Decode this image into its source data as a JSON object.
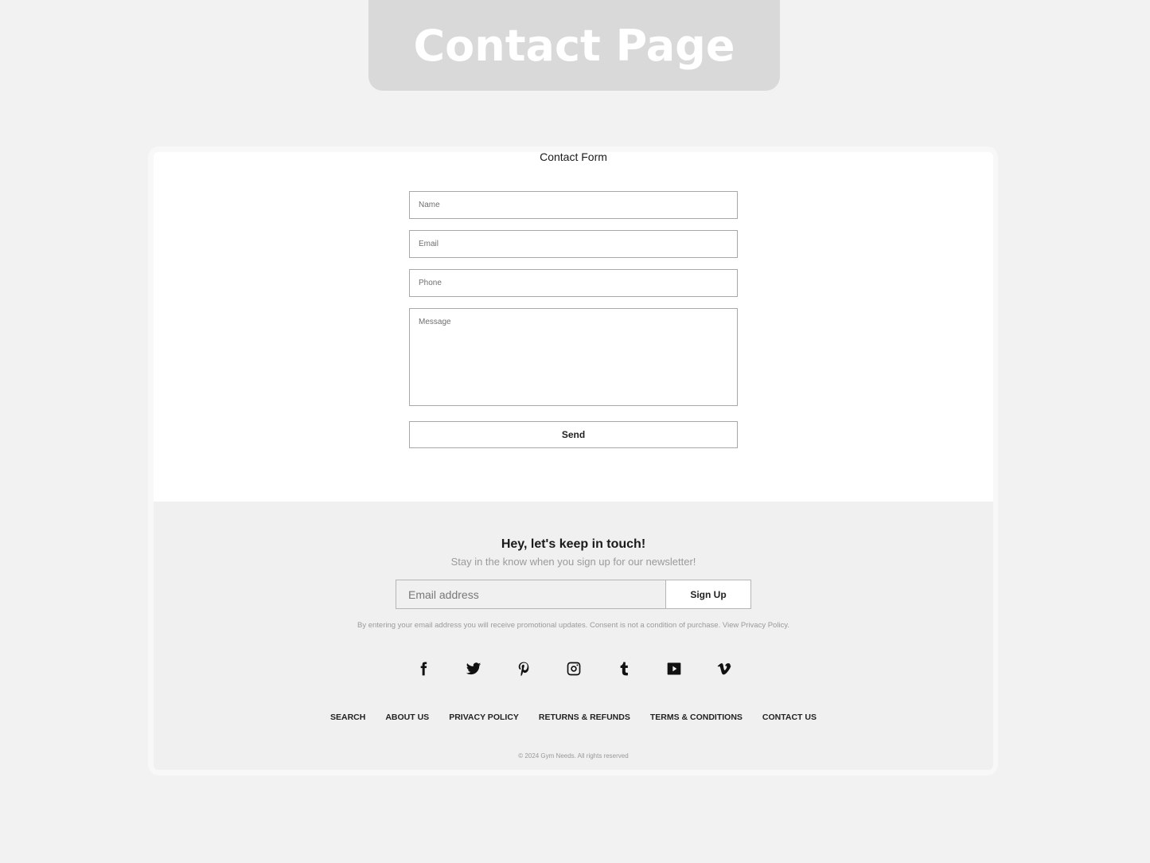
{
  "banner": {
    "title": "Contact Page"
  },
  "form": {
    "title": "Contact Form",
    "fields": [
      {
        "name": "name",
        "placeholder": "Name",
        "value": ""
      },
      {
        "name": "email",
        "placeholder": "Email",
        "value": ""
      },
      {
        "name": "phone",
        "placeholder": "Phone",
        "value": ""
      },
      {
        "name": "message",
        "placeholder": "Message",
        "value": ""
      }
    ],
    "send_label": "Send"
  },
  "footer": {
    "newsletter_title": "Hey, let's keep in touch!",
    "newsletter_subtitle": "Stay in the know when you sign up for our newsletter!",
    "email_placeholder": "Email address",
    "signup_label": "Sign Up",
    "consent_text": "By entering your email address you will receive promotional updates. Consent is not a condition of purchase. View Privacy Policy.",
    "social_icons": [
      "facebook-icon",
      "twitter-icon",
      "pinterest-icon",
      "instagram-icon",
      "tumblr-icon",
      "youtube-icon",
      "vimeo-icon"
    ],
    "links": [
      "SEARCH",
      "ABOUT US",
      "PRIVACY POLICY",
      "RETURNS & REFUNDS",
      "TERMS & CONDITIONS",
      "CONTACT US"
    ],
    "copyright": "© 2024 Gym Needs. All rights reserved"
  }
}
